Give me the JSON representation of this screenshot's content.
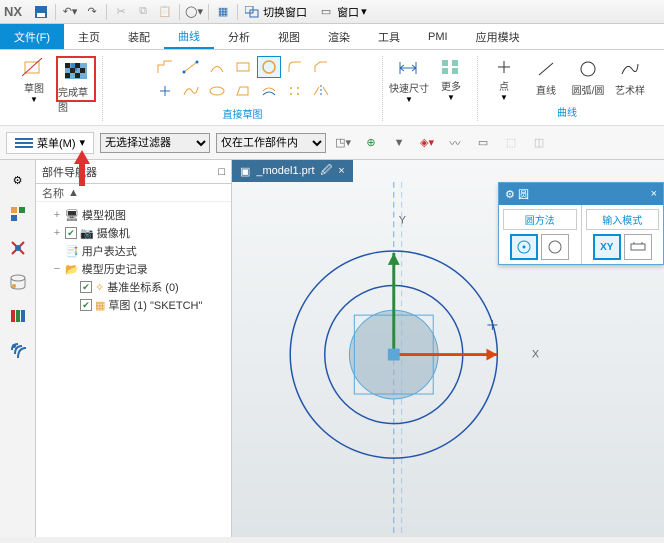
{
  "titlebar": {
    "app": "NX",
    "switch_window": "切换窗口",
    "window": "窗口"
  },
  "menu": {
    "file": "文件(F)",
    "home": "主页",
    "assemble": "装配",
    "curve": "曲线",
    "analyze": "分析",
    "view": "视图",
    "render": "渲染",
    "tool": "工具",
    "pmi": "PMI",
    "app_module": "应用模块"
  },
  "ribbon": {
    "sketch": {
      "label": "草图"
    },
    "finish": {
      "label": "完成草图"
    },
    "direct_sketch": "直接草图",
    "rapid_dim": "快速尺寸",
    "more": "更多",
    "point": "点",
    "line": "直线",
    "arc": "圆弧/圆",
    "art": "艺术样",
    "curves": "曲线"
  },
  "toolbar": {
    "menu": "菜单(M)",
    "filter_none": "无选择过滤器",
    "scope": "仅在工作部件内"
  },
  "nav": {
    "title": "部件导航器",
    "name_col": "名称",
    "model_view": "模型视图",
    "camera": "摄像机",
    "user_expr": "用户表达式",
    "history": "模型历史记录",
    "datum": "基准坐标系 (0)",
    "sketch_item": "草图 (1) \"SKETCH\""
  },
  "doc": {
    "tab": "_model1.prt"
  },
  "axes": {
    "x": "X",
    "y": "Y"
  },
  "circle_panel": {
    "title": "圆",
    "method": "圆方法",
    "input_mode": "输入模式",
    "xy": "XY"
  }
}
